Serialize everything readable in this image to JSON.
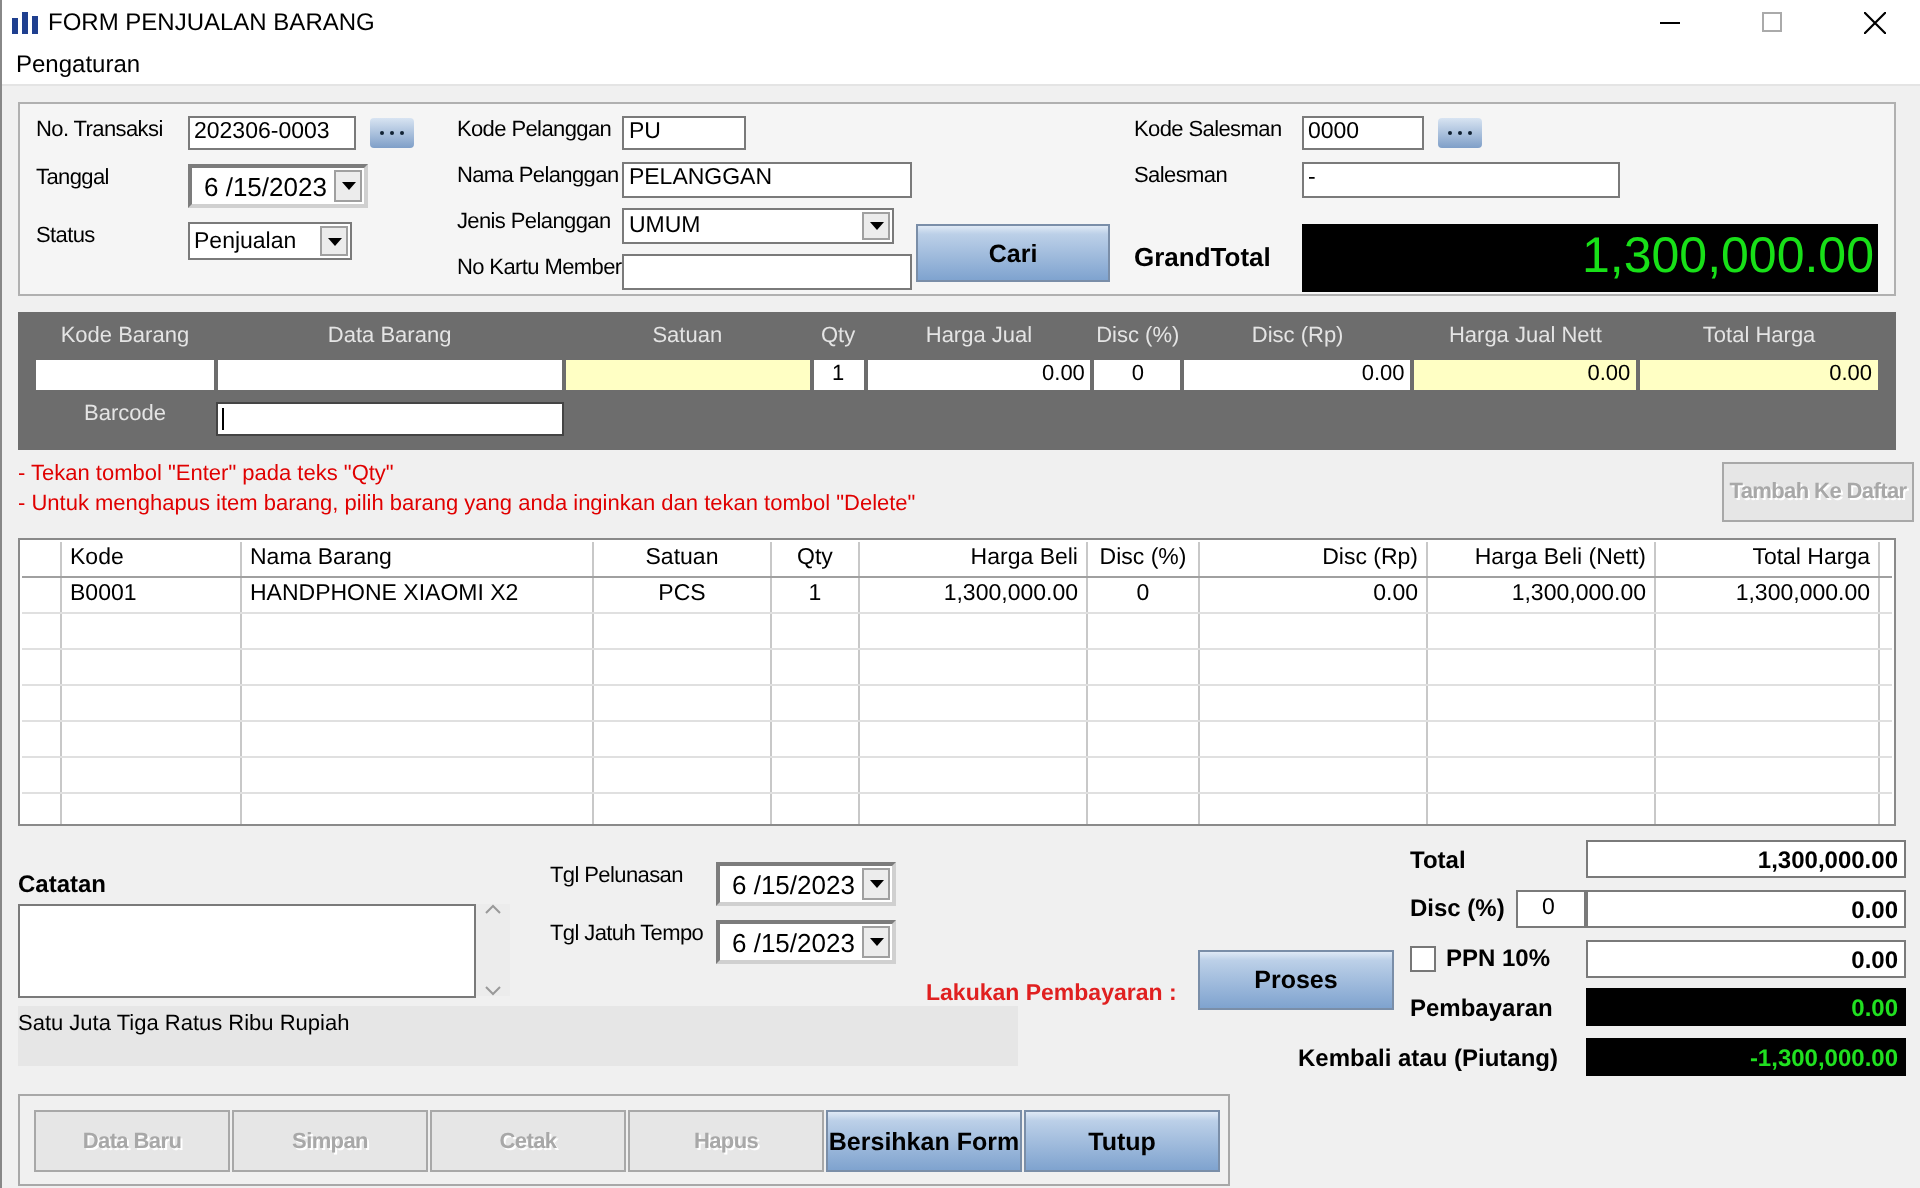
{
  "window": {
    "title": "FORM PENJUALAN BARANG"
  },
  "menu": [
    "Pengaturan"
  ],
  "transaction": {
    "number": {
      "label": "No. Transaksi",
      "value": "202306-0003"
    },
    "date": {
      "label": "Tanggal",
      "value": "6 /15/2023"
    },
    "status": {
      "label": "Status",
      "value": "Penjualan"
    }
  },
  "customer": {
    "code": {
      "label": "Kode Pelanggan",
      "value": "PU"
    },
    "name": {
      "label": "Nama Pelanggan",
      "value": "PELANGGAN"
    },
    "type": {
      "label": "Jenis Pelanggan",
      "value": "UMUM"
    },
    "member_card": {
      "label": "No Kartu Member"
    }
  },
  "search_button": "Cari",
  "salesman": {
    "code": {
      "label": "Kode Salesman",
      "value": "0000"
    },
    "name": {
      "label": "Salesman",
      "value": "-"
    }
  },
  "grand_total": {
    "label": "GrandTotal",
    "value": "1,300,000.00"
  },
  "entry": {
    "columns": [
      {
        "label": "Kode Barang",
        "kind": "text",
        "highlight": false
      },
      {
        "label": "Data Barang",
        "kind": "text",
        "highlight": false
      },
      {
        "label": "Satuan",
        "kind": "text",
        "highlight": true
      },
      {
        "label": "Qty",
        "kind": "count",
        "value": "1",
        "highlight": false
      },
      {
        "label": "Harga Jual",
        "kind": "number",
        "value": "0.00",
        "highlight": false
      },
      {
        "label": "Disc (%)",
        "kind": "count",
        "value": "0",
        "highlight": false
      },
      {
        "label": "Disc (Rp)",
        "kind": "number",
        "value": "0.00",
        "highlight": false
      },
      {
        "label": "Harga Jual Nett",
        "kind": "number",
        "value": "0.00",
        "highlight": true
      },
      {
        "label": "Total Harga",
        "kind": "number",
        "value": "0.00",
        "highlight": true
      }
    ],
    "barcode": {
      "label": "Barcode"
    }
  },
  "notes": [
    "- Tekan tombol \"Enter\" pada teks \"Qty\"",
    "- Untuk menghapus item barang, pilih barang yang anda inginkan dan tekan tombol \"Delete\""
  ],
  "add_button": {
    "label": "Tambah Ke Daftar",
    "disabled": true
  },
  "table": {
    "columns": [
      {
        "label": "Kode",
        "kind": "text"
      },
      {
        "label": "Nama Barang",
        "kind": "text"
      },
      {
        "label": "Satuan",
        "kind": "center"
      },
      {
        "label": "Qty",
        "kind": "center"
      },
      {
        "label": "Harga Beli",
        "kind": "number"
      },
      {
        "label": "Disc (%)",
        "kind": "center"
      },
      {
        "label": "Disc (Rp)",
        "kind": "number"
      },
      {
        "label": "Harga Beli (Nett)",
        "kind": "number"
      },
      {
        "label": "Total Harga",
        "kind": "number"
      }
    ],
    "rows": [
      {
        "cells": [
          "B0001",
          "HANDPHONE XIAOMI X2",
          "PCS",
          "1",
          "1,300,000.00",
          "0",
          "0.00",
          "1,300,000.00",
          "1,300,000.00"
        ]
      }
    ]
  },
  "note_field": {
    "label": "Catatan"
  },
  "amount_in_words": "Satu Juta Tiga Ratus Ribu Rupiah",
  "dates": [
    {
      "label": "Tgl Pelunasan",
      "value": "6 /15/2023"
    },
    {
      "label": "Tgl Jatuh Tempo",
      "value": "6 /15/2023"
    }
  ],
  "payment_prompt": "Lakukan Pembayaran :",
  "process_button": "Proses",
  "summary": {
    "total": {
      "label": "Total",
      "value": "1,300,000.00"
    },
    "discount": {
      "label": "Disc (%)",
      "percent": "0",
      "value": "0.00"
    },
    "tax": {
      "label": "PPN 10%",
      "checked": false,
      "value": "0.00"
    },
    "payment": {
      "label": "Pembayaran",
      "value": "0.00"
    },
    "change": {
      "label": "Kembali atau (Piutang)",
      "value": "-1,300,000.00"
    }
  },
  "buttons": [
    {
      "label": "Data Baru",
      "disabled": true
    },
    {
      "label": "Simpan",
      "disabled": true
    },
    {
      "label": "Cetak",
      "disabled": true
    },
    {
      "label": "Hapus",
      "disabled": true
    },
    {
      "label": "Bersihkan Form",
      "disabled": false
    },
    {
      "label": "Tutup",
      "disabled": false
    }
  ]
}
